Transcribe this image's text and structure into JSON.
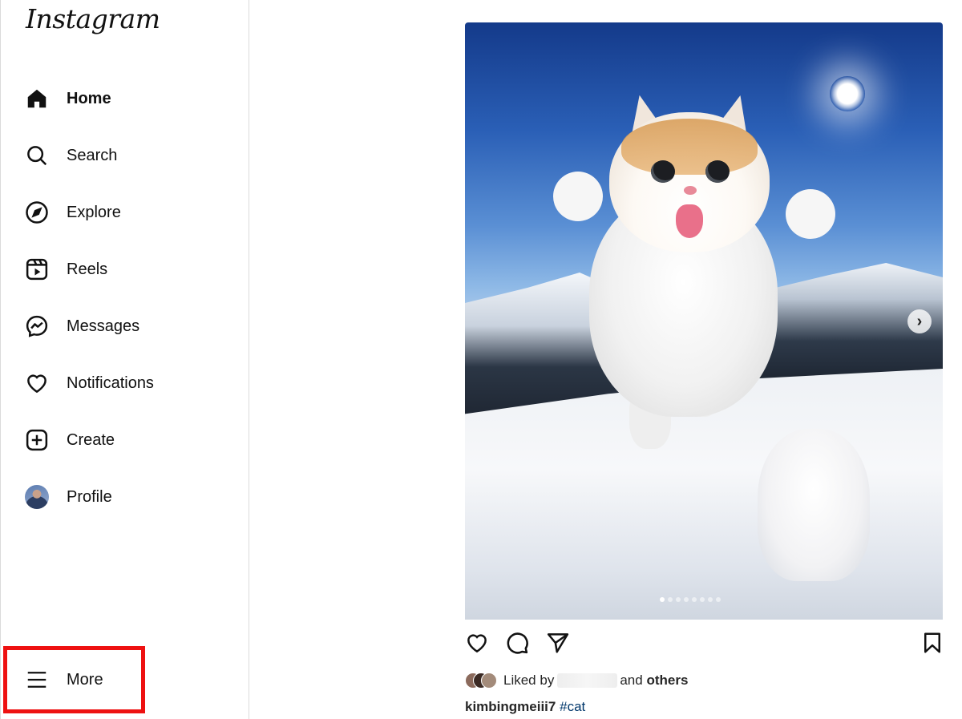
{
  "app": {
    "logo_text": "Instagram"
  },
  "sidebar": {
    "items": [
      {
        "label": "Home",
        "icon": "home-icon",
        "active": true
      },
      {
        "label": "Search",
        "icon": "search-icon"
      },
      {
        "label": "Explore",
        "icon": "compass-icon"
      },
      {
        "label": "Reels",
        "icon": "reels-icon"
      },
      {
        "label": "Messages",
        "icon": "messenger-icon"
      },
      {
        "label": "Notifications",
        "icon": "heart-icon"
      },
      {
        "label": "Create",
        "icon": "plus-square-icon"
      },
      {
        "label": "Profile",
        "icon": "avatar"
      }
    ],
    "more": {
      "label": "More",
      "icon": "hamburger-menu-icon",
      "highlighted": true,
      "highlight_color": "#e11111"
    }
  },
  "post": {
    "carousel": {
      "total_slides": 8,
      "active_slide": 1
    },
    "liked_by": {
      "prefix": "Liked by",
      "middle": "and",
      "suffix": "others"
    },
    "caption": {
      "username": "kimbingmeiii7",
      "hashtag": "#cat"
    }
  },
  "colors": {
    "link": "#00376b",
    "border": "#dbdbdb",
    "text": "#262626"
  }
}
